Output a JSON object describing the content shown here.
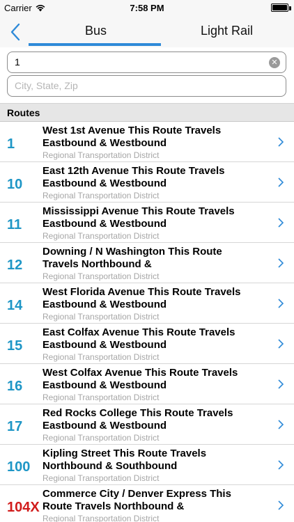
{
  "status": {
    "carrier": "Carrier",
    "time": "7:58 PM"
  },
  "tabs": [
    {
      "label": "Bus",
      "selected": true
    },
    {
      "label": "Light Rail",
      "selected": false
    }
  ],
  "search": {
    "route_value": "1",
    "city_placeholder": "City, State, Zip"
  },
  "section": {
    "title": "Routes"
  },
  "routes": [
    {
      "number": "1",
      "title": "West 1st Avenue This Route Travels Eastbound & Westbound",
      "agency": "Regional Transportation District"
    },
    {
      "number": "10",
      "title": "East 12th Avenue This Route Travels Eastbound & Westbound",
      "agency": "Regional Transportation District"
    },
    {
      "number": "11",
      "title": "Mississippi Avenue This Route Travels Eastbound & Westbound",
      "agency": "Regional Transportation District"
    },
    {
      "number": "12",
      "title": "Downing / N Washington This Route Travels Northbound &",
      "agency": "Regional Transportation District"
    },
    {
      "number": "14",
      "title": "West Florida Avenue This Route Travels Eastbound & Westbound",
      "agency": "Regional Transportation District"
    },
    {
      "number": "15",
      "title": "East Colfax Avenue This Route Travels Eastbound & Westbound",
      "agency": "Regional Transportation District"
    },
    {
      "number": "16",
      "title": "West Colfax Avenue This Route Travels Eastbound & Westbound",
      "agency": "Regional Transportation District"
    },
    {
      "number": "17",
      "title": "Red Rocks College This Route Travels Eastbound & Westbound",
      "agency": "Regional Transportation District"
    },
    {
      "number": "100",
      "title": "Kipling Street This Route Travels Northbound & Southbound",
      "agency": "Regional Transportation District"
    },
    {
      "number": "104X",
      "title": "Commerce City / Denver Express This Route Travels Northbound &",
      "agency": "Regional Transportation District",
      "express": true
    }
  ],
  "colors": {
    "accent": "#2e8ad8",
    "route_number": "#1e96c6",
    "express_number": "#d11c1c"
  }
}
